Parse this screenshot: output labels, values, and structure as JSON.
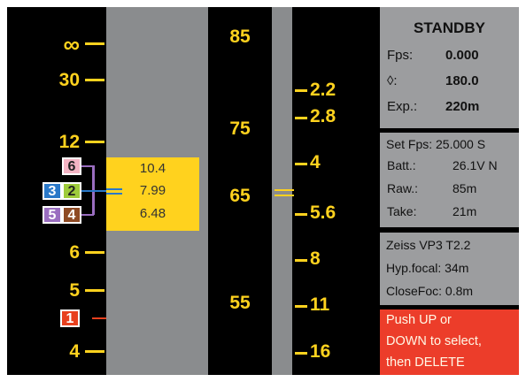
{
  "distance_scale": {
    "labels": [
      "∞",
      "30",
      "12",
      "6",
      "5",
      "4"
    ]
  },
  "focus_readout": {
    "far": "10.4",
    "focus": "7.99",
    "near": "6.48"
  },
  "lens_markers": [
    "6",
    "3",
    "2",
    "5",
    "4",
    "1"
  ],
  "fstop_scale": {
    "center_labels": [
      "85",
      "75",
      "65",
      "55"
    ],
    "right_labels": [
      "2.2",
      "2.8",
      "4",
      "5.6",
      "8",
      "11",
      "16"
    ]
  },
  "status": {
    "title": "STANDBY",
    "fps_label": "Fps:",
    "fps_value": "0.000",
    "shutter_label": "◊:",
    "shutter_value": "180.0",
    "exp_label": "Exp.:",
    "exp_value": "220m"
  },
  "settings": {
    "set_fps": "Set Fps: 25.000 S",
    "batt_label": "Batt.:",
    "batt_value": "26.1V N",
    "raw_label": "Raw.:",
    "raw_value": "85m",
    "take_label": "Take:",
    "take_value": "21m"
  },
  "lens": {
    "name": "Zeiss VP3 T2.2",
    "hyperfocal": "Hyp.focal: 34m",
    "close_focus": "CloseFoc: 0.8m"
  },
  "warning": {
    "line1": "Push UP or",
    "line2": "DOWN to select,",
    "line3": "then DELETE"
  },
  "colors": {
    "accent_yellow": "#ffd21e",
    "warning_red": "#ec3d2a",
    "panel_gray": "#9c9d9f",
    "marker_pink": "#f4b4c4",
    "marker_blue": "#2a78c8",
    "marker_green": "#9ecb3c",
    "marker_purple": "#9a6ec0",
    "marker_brown": "#8e4a24",
    "marker_red": "#e8401e"
  }
}
